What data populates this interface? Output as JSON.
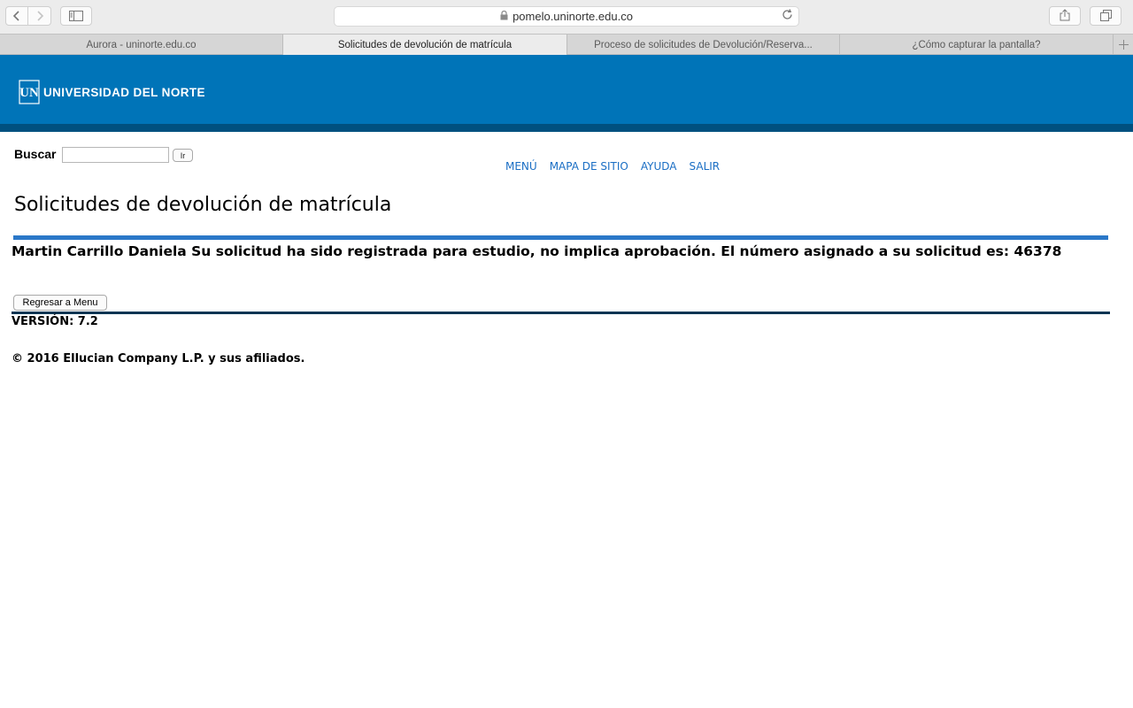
{
  "browser": {
    "url": "pomelo.uninorte.edu.co",
    "tabs": [
      {
        "label": "Aurora - uninorte.edu.co"
      },
      {
        "label": "Solicitudes de devolución de matrícula"
      },
      {
        "label": "Proceso de solicitudes de Devolución/Reserva..."
      },
      {
        "label": "¿Cómo capturar la pantalla?"
      }
    ],
    "active_tab": 1
  },
  "header": {
    "logo_mark": "UN",
    "logo_text": "UNIVERSIDAD DEL NORTE",
    "banner_color": "#0074b8"
  },
  "search": {
    "label": "Buscar",
    "value": "",
    "button_label": "Ir"
  },
  "nav": {
    "items": [
      {
        "label": "MENÚ"
      },
      {
        "label": "MAPA DE SITIO"
      },
      {
        "label": "AYUDA"
      },
      {
        "label": "SALIR"
      }
    ]
  },
  "main": {
    "title": "Solicitudes de devolución de matrícula",
    "message": "Martin Carrillo Daniela Su solicitud ha sido registrada para estudio, no implica aprobación. El número asignado a su solicitud es: 46378",
    "back_button_label": "Regresar a Menu"
  },
  "footer": {
    "version": "VERSIÓN: 7.2",
    "copyright": "© 2016 Ellucian Company L.P. y sus afiliados."
  }
}
